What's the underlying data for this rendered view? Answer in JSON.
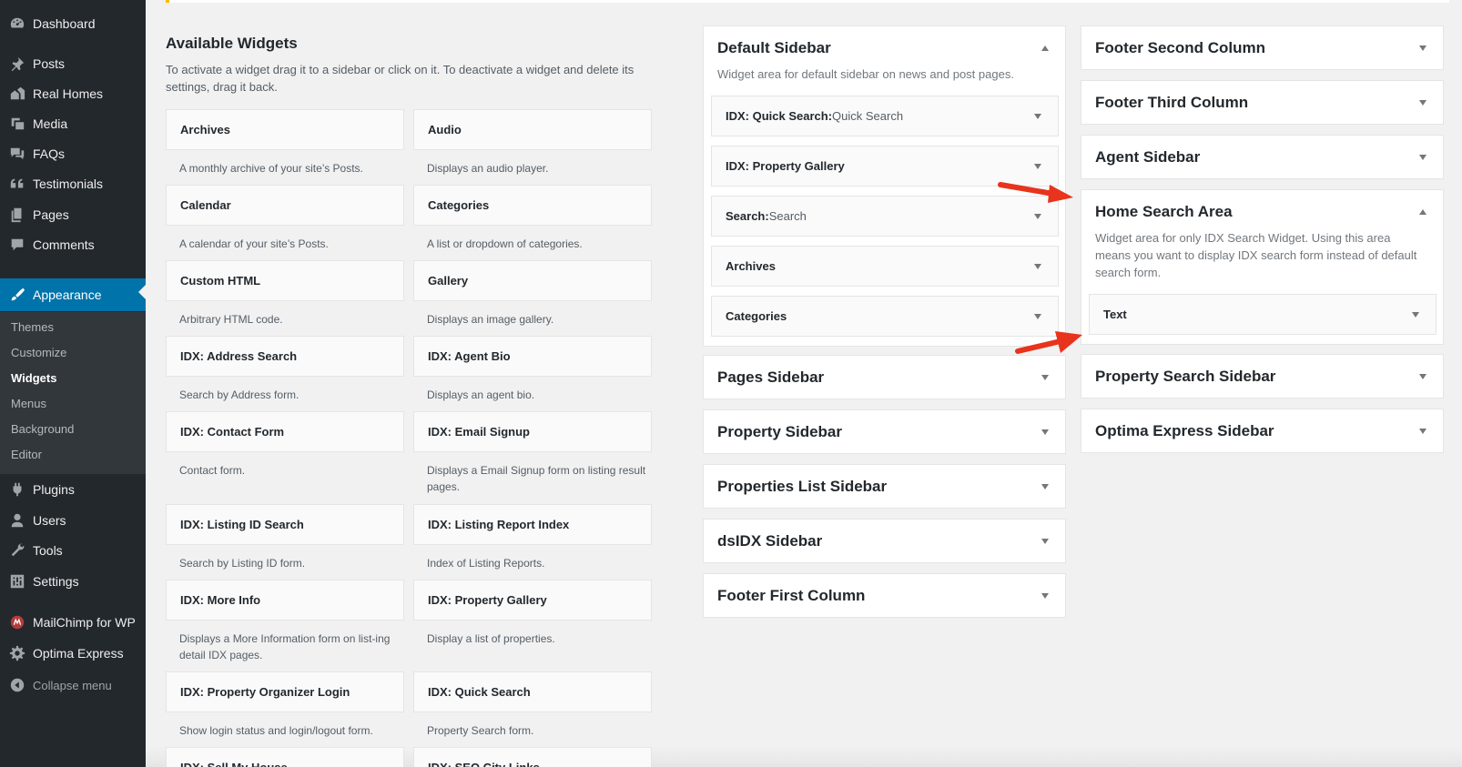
{
  "menu": {
    "items": [
      {
        "label": "Dashboard",
        "icon": "dashboard-icon"
      },
      {
        "label": "Posts",
        "icon": "pin-icon"
      },
      {
        "label": "Real Homes",
        "icon": "homes-icon"
      },
      {
        "label": "Media",
        "icon": "media-icon"
      },
      {
        "label": "FAQs",
        "icon": "faq-icon"
      },
      {
        "label": "Testimonials",
        "icon": "quote-icon"
      },
      {
        "label": "Pages",
        "icon": "pages-icon"
      },
      {
        "label": "Comments",
        "icon": "comments-icon"
      },
      {
        "label": "Appearance",
        "icon": "appearance-icon"
      },
      {
        "label": "Plugins",
        "icon": "plugins-icon"
      },
      {
        "label": "Users",
        "icon": "users-icon"
      },
      {
        "label": "Tools",
        "icon": "tools-icon"
      },
      {
        "label": "Settings",
        "icon": "settings-icon"
      },
      {
        "label": "MailChimp for WP",
        "icon": "mailchimp-icon"
      },
      {
        "label": "Optima Express",
        "icon": "gear-icon"
      }
    ],
    "submenu": [
      "Themes",
      "Customize",
      "Widgets",
      "Menus",
      "Background",
      "Editor"
    ],
    "active_submenu": "Widgets",
    "collapse_label": "Collapse menu"
  },
  "available": {
    "title": "Available Widgets",
    "description": "To activate a widget drag it to a sidebar or click on it. To deactivate a widget and delete its settings, drag it back.",
    "widgets": [
      {
        "name": "Archives",
        "desc": "A monthly archive of your site’s Posts."
      },
      {
        "name": "Audio",
        "desc": "Displays an audio player."
      },
      {
        "name": "Calendar",
        "desc": "A calendar of your site’s Posts."
      },
      {
        "name": "Categories",
        "desc": "A list or dropdown of categories."
      },
      {
        "name": "Custom HTML",
        "desc": "Arbitrary HTML code."
      },
      {
        "name": "Gallery",
        "desc": "Displays an image gallery."
      },
      {
        "name": "IDX: Address Search",
        "desc": "Search by Address form."
      },
      {
        "name": "IDX: Agent Bio",
        "desc": "Displays an agent bio."
      },
      {
        "name": "IDX: Contact Form",
        "desc": "Contact form."
      },
      {
        "name": "IDX: Email Signup",
        "desc": "Displays a Email Signup form on listing result pages."
      },
      {
        "name": "IDX: Listing ID Search",
        "desc": "Search by Listing ID form."
      },
      {
        "name": "IDX: Listing Report Index",
        "desc": "Index of Listing Reports."
      },
      {
        "name": "IDX: More Info",
        "desc": "Displays a More Information form on list-ing detail IDX pages."
      },
      {
        "name": "IDX: Property Gallery",
        "desc": "Display a list of properties."
      },
      {
        "name": "IDX: Property Organizer Login",
        "desc": "Show login status and login/logout form."
      },
      {
        "name": "IDX: Quick Search",
        "desc": "Property Search form."
      },
      {
        "name": "IDX: Sell My House",
        "desc": ""
      },
      {
        "name": "IDX: SEO City Links",
        "desc": ""
      }
    ]
  },
  "default_sidebar": {
    "title": "Default Sidebar",
    "description": "Widget area for default sidebar on news and post pages.",
    "widgets": [
      {
        "name": "IDX: Quick Search:",
        "sub": " Quick Search"
      },
      {
        "name": "IDX: Property Gallery",
        "sub": ""
      },
      {
        "name": "Search:",
        "sub": " Search"
      },
      {
        "name": "Archives",
        "sub": ""
      },
      {
        "name": "Categories",
        "sub": ""
      }
    ]
  },
  "middle_areas": [
    "Pages Sidebar",
    "Property Sidebar",
    "Properties List Sidebar",
    "dsIDX Sidebar",
    "Footer First Column"
  ],
  "right_areas_top": [
    "Footer Second Column",
    "Footer Third Column",
    "Agent Sidebar"
  ],
  "home_search": {
    "title": "Home Search Area",
    "description": "Widget area for only IDX Search Widget. Using this area means you want to display IDX search form instead of default search form.",
    "widget": "Text"
  },
  "right_areas_bottom": [
    "Property Search Sidebar",
    "Optima Express Sidebar"
  ],
  "colors": {
    "accent": "#0073aa",
    "menu_bg": "#23282d",
    "arrow": "#e8341c"
  }
}
